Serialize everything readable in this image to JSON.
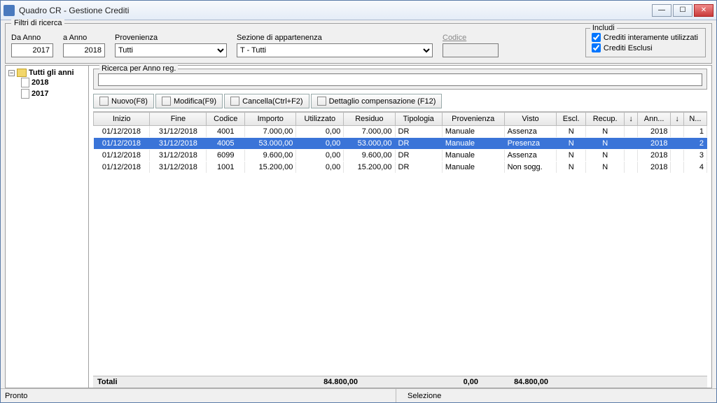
{
  "window": {
    "title": "Quadro CR - Gestione Crediti"
  },
  "filters": {
    "legend": "Filtri di ricerca",
    "daAnno": {
      "label": "Da Anno",
      "value": "2017"
    },
    "aAnno": {
      "label": "a Anno",
      "value": "2018"
    },
    "provenienza": {
      "label": "Provenienza",
      "value": "Tutti"
    },
    "sezione": {
      "label": "Sezione di appartenenza",
      "value": "T - Tutti"
    },
    "codice": {
      "label": "Codice",
      "value": ""
    },
    "includi": {
      "legend": "Includi",
      "utilizzati": "Crediti interamente utilizzati",
      "esclusi": "Crediti Esclusi"
    }
  },
  "tree": {
    "root": "Tutti gli anni",
    "items": [
      "2018",
      "2017"
    ]
  },
  "search": {
    "legend": "Ricerca per Anno reg.",
    "value": ""
  },
  "toolbar": {
    "nuovo": "Nuovo(F8)",
    "modifica": "Modifica(F9)",
    "cancella": "Cancella(Ctrl+F2)",
    "dettaglio": "Dettaglio compensazione (F12)"
  },
  "columns": [
    "Inizio",
    "Fine",
    "Codice",
    "Importo",
    "Utilizzato",
    "Residuo",
    "Tipologia",
    "Provenienza",
    "Visto",
    "Escl.",
    "Recup.",
    "↓",
    "Ann...",
    "↓",
    "N..."
  ],
  "rows": [
    {
      "inizio": "01/12/2018",
      "fine": "31/12/2018",
      "codice": "4001",
      "importo": "7.000,00",
      "util": "0,00",
      "resid": "7.000,00",
      "tip": "DR",
      "prov": "Manuale",
      "visto": "Assenza",
      "escl": "N",
      "recup": "N",
      "a1": "",
      "anno": "2018",
      "a2": "",
      "n": "1",
      "sel": false
    },
    {
      "inizio": "01/12/2018",
      "fine": "31/12/2018",
      "codice": "4005",
      "importo": "53.000,00",
      "util": "0,00",
      "resid": "53.000,00",
      "tip": "DR",
      "prov": "Manuale",
      "visto": "Presenza",
      "escl": "N",
      "recup": "N",
      "a1": "",
      "anno": "2018",
      "a2": "",
      "n": "2",
      "sel": true
    },
    {
      "inizio": "01/12/2018",
      "fine": "31/12/2018",
      "codice": "6099",
      "importo": "9.600,00",
      "util": "0,00",
      "resid": "9.600,00",
      "tip": "DR",
      "prov": "Manuale",
      "visto": "Assenza",
      "escl": "N",
      "recup": "N",
      "a1": "",
      "anno": "2018",
      "a2": "",
      "n": "3",
      "sel": false
    },
    {
      "inizio": "01/12/2018",
      "fine": "31/12/2018",
      "codice": "1001",
      "importo": "15.200,00",
      "util": "0,00",
      "resid": "15.200,00",
      "tip": "DR",
      "prov": "Manuale",
      "visto": "Non sogg.",
      "escl": "N",
      "recup": "N",
      "a1": "",
      "anno": "2018",
      "a2": "",
      "n": "4",
      "sel": false
    }
  ],
  "totals": {
    "label": "Totali",
    "importo": "84.800,00",
    "util": "0,00",
    "resid": "84.800,00"
  },
  "status": {
    "pronto": "Pronto",
    "selezione": "Selezione"
  }
}
